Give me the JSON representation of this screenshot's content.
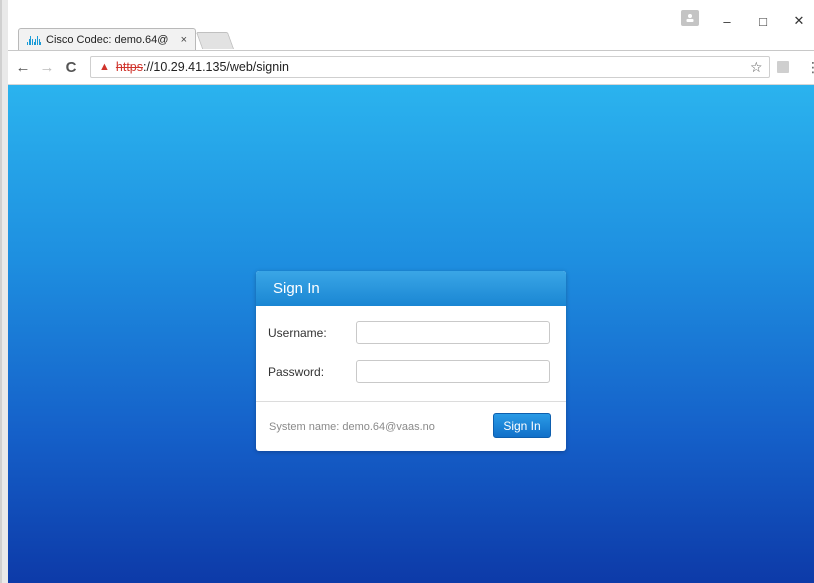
{
  "browser": {
    "tab_title": "Cisco Codec: demo.64@",
    "tab_close": "×",
    "favicon": "cisco-logo-icon",
    "window_controls": {
      "minimize": "–",
      "maximize": "□",
      "close": "✕"
    },
    "nav": {
      "back": "←",
      "forward": "→",
      "reload": "C"
    },
    "address": {
      "warning_icon": "▲",
      "scheme": "https",
      "rest": "://10.29.41.135/web/signin"
    },
    "bookmark_star": "☆",
    "menu": "⋮"
  },
  "signin": {
    "title": "Sign In",
    "username_label": "Username:",
    "username_value": "",
    "password_label": "Password:",
    "password_value": "",
    "system_name": "System name: demo.64@vaas.no",
    "button_label": "Sign In"
  },
  "colors": {
    "page_gradient_top": "#2bb3ee",
    "page_gradient_bottom": "#0d3aa8",
    "header_blue": "#1a86d3",
    "button_blue": "#1170c9",
    "insecure_red": "#d0342c"
  }
}
